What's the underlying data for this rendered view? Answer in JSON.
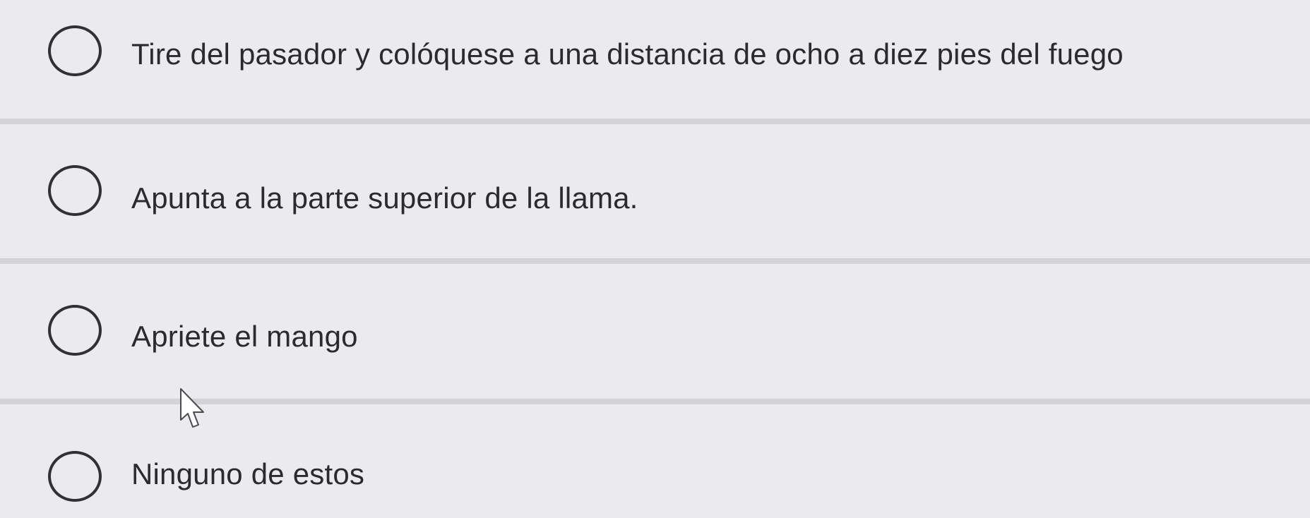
{
  "question": {
    "options": [
      {
        "label": "Tire del pasador y colóquese a una distancia de ocho a diez pies del fuego",
        "selected": false
      },
      {
        "label": "Apunta a la parte superior de la llama.",
        "selected": false
      },
      {
        "label": "Apriete el mango",
        "selected": false
      },
      {
        "label": "Ninguno de estos",
        "selected": false
      }
    ]
  },
  "colors": {
    "background": "#ebebed",
    "divider": "#d4d4d6",
    "radio_border": "#2f3134",
    "text": "#2a2b2e"
  },
  "cursor": {
    "icon": "arrow-pointer-icon"
  }
}
